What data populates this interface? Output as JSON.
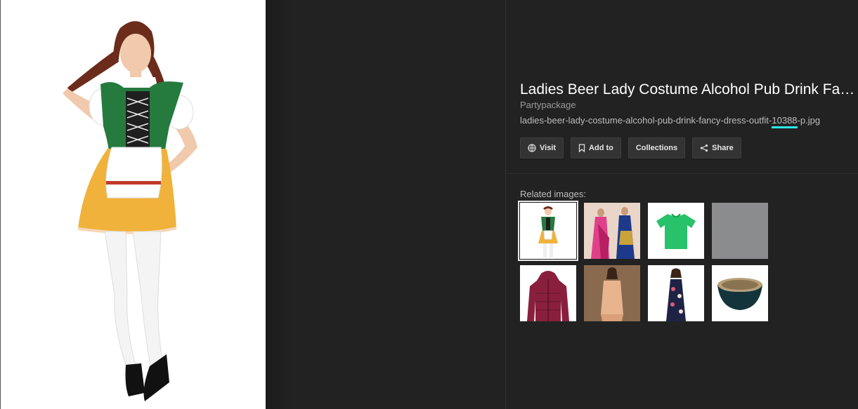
{
  "detail": {
    "title": "Ladies Beer Lady Costume Alcohol Pub Drink Fancy Dress Outfit",
    "source": "Partypackage",
    "filename_prefix": "ladies-beer-lady-costume-alcohol-pub-drink-fancy-dress-outfit-",
    "filename_highlight": "10388",
    "filename_suffix": "-p.jpg"
  },
  "actions": {
    "visit_label": "Visit",
    "add_to_label": "Add to",
    "collections_label": "Collections",
    "share_label": "Share"
  },
  "icons": {
    "visit": "globe-icon",
    "add_to": "bookmark-icon",
    "share": "share-icon"
  },
  "related": {
    "label": "Related images:"
  },
  "colors": {
    "background": "#222222",
    "highlight": "#2ee6e6",
    "button": "#333333"
  }
}
